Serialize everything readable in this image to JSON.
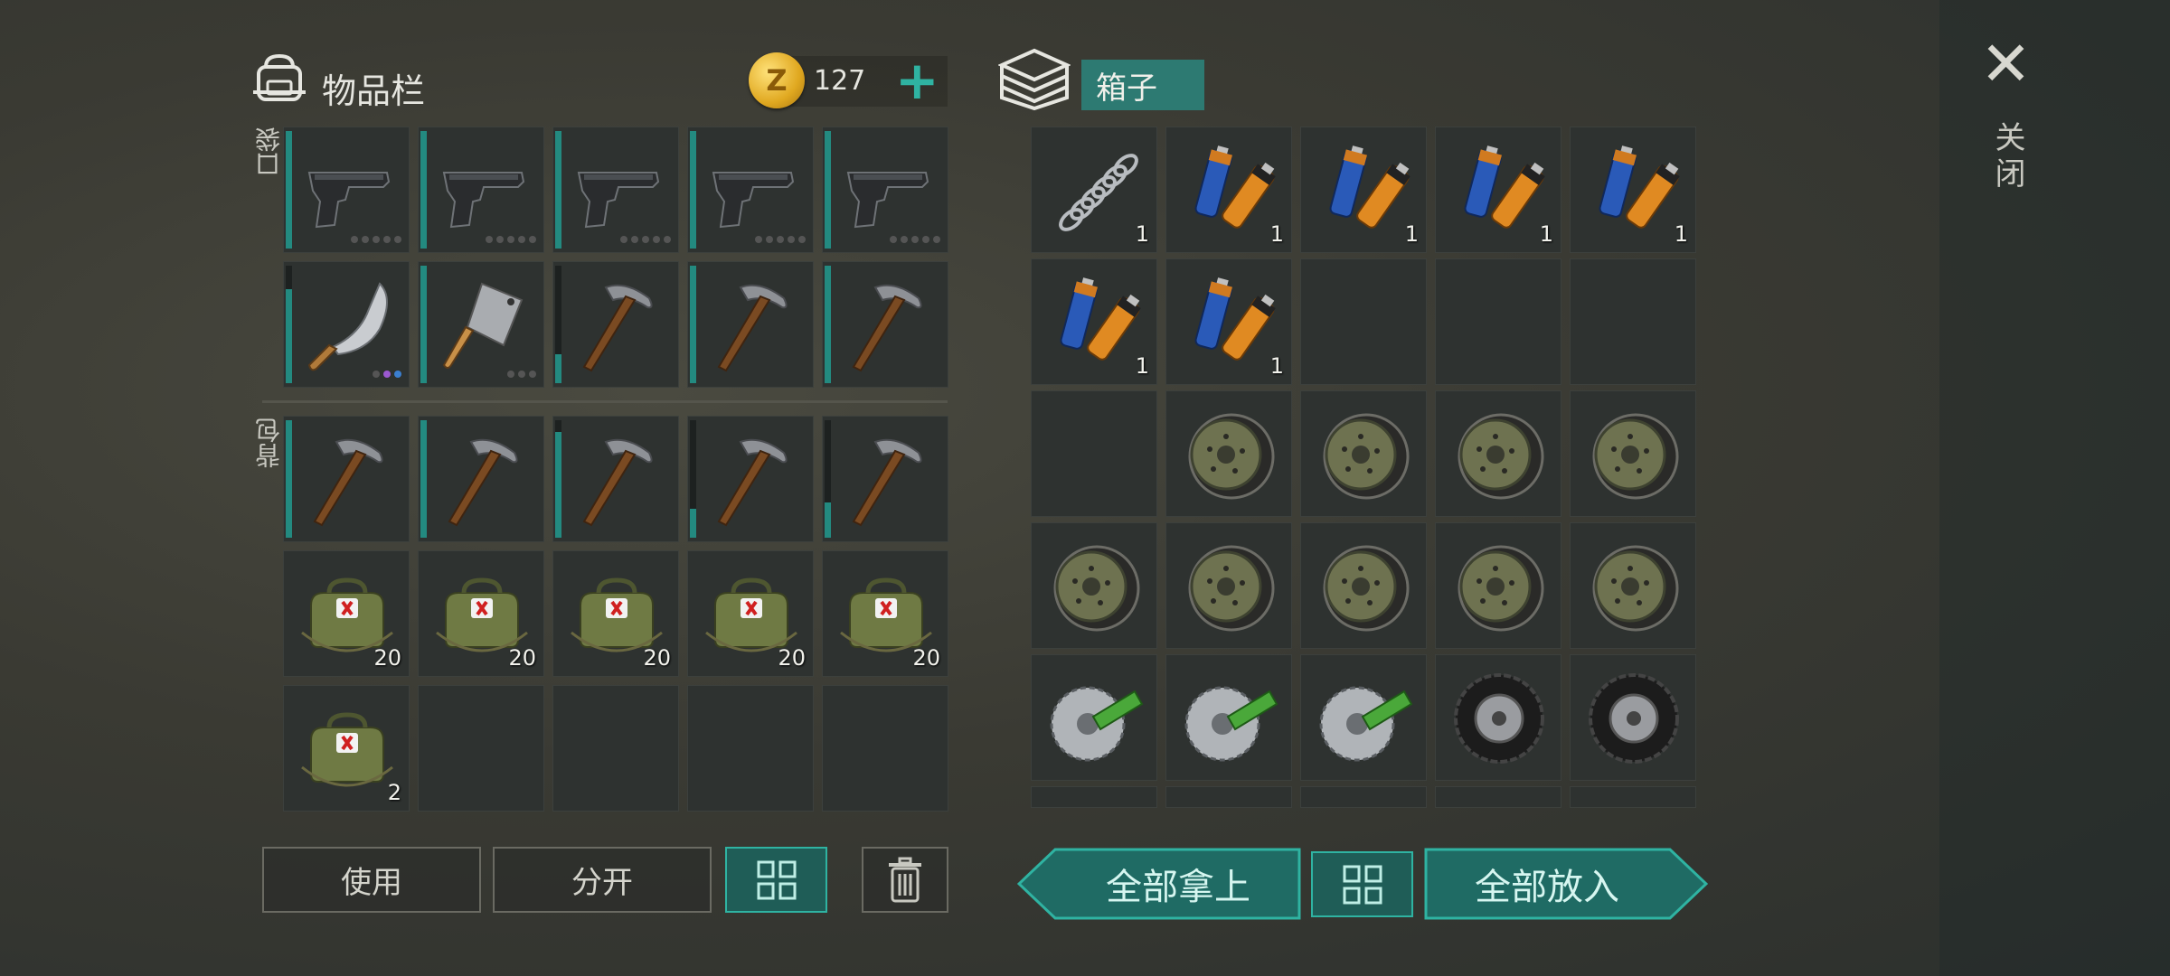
{
  "inventory": {
    "title": "物品栏",
    "coins": "127",
    "plus": "+",
    "pocket_label": "口袋",
    "backpack_label": "背包"
  },
  "container": {
    "title": "箱子"
  },
  "close": {
    "label": "关闭",
    "icon": "close-icon"
  },
  "buttons": {
    "use": "使用",
    "split": "分开",
    "take_all": "全部拿上",
    "put_all": "全部放入"
  },
  "pocket_slots": [
    {
      "item": "pistol-icon",
      "durability": 1.0,
      "dots": [
        "gray",
        "gray",
        "gray",
        "gray",
        "gray"
      ]
    },
    {
      "item": "pistol-icon",
      "durability": 1.0,
      "dots": [
        "gray",
        "gray",
        "gray",
        "gray",
        "gray"
      ]
    },
    {
      "item": "pistol-icon",
      "durability": 1.0,
      "dots": [
        "gray",
        "gray",
        "gray",
        "gray",
        "gray"
      ]
    },
    {
      "item": "pistol-icon",
      "durability": 1.0,
      "dots": [
        "gray",
        "gray",
        "gray",
        "gray",
        "gray"
      ]
    },
    {
      "item": "pistol-icon",
      "durability": 1.0,
      "dots": [
        "gray",
        "gray",
        "gray",
        "gray",
        "gray"
      ]
    },
    {
      "item": "machete-icon",
      "durability": 0.8,
      "dots": [
        "gray",
        "purple",
        "blue"
      ]
    },
    {
      "item": "cleaver-icon",
      "durability": 1.0,
      "dots": [
        "gray",
        "gray",
        "gray"
      ]
    },
    {
      "item": "pickaxe-icon",
      "durability": 0.25
    },
    {
      "item": "pickaxe-icon",
      "durability": 1.0
    },
    {
      "item": "pickaxe-icon",
      "durability": 1.0
    }
  ],
  "backpack_slots": [
    {
      "item": "pickaxe-icon",
      "durability": 1.0
    },
    {
      "item": "pickaxe-icon",
      "durability": 1.0
    },
    {
      "item": "pickaxe-icon",
      "durability": 0.9
    },
    {
      "item": "pickaxe-icon",
      "durability": 0.25
    },
    {
      "item": "pickaxe-icon",
      "durability": 0.3
    },
    {
      "item": "medkit-bag-icon",
      "qty": "20"
    },
    {
      "item": "medkit-bag-icon",
      "qty": "20"
    },
    {
      "item": "medkit-bag-icon",
      "qty": "20"
    },
    {
      "item": "medkit-bag-icon",
      "qty": "20"
    },
    {
      "item": "medkit-bag-icon",
      "qty": "20"
    },
    {
      "item": "medkit-bag-icon",
      "qty": "2"
    },
    {
      "item": ""
    },
    {
      "item": ""
    },
    {
      "item": ""
    },
    {
      "item": ""
    }
  ],
  "container_slots": [
    {
      "item": "spring-icon",
      "qty": "1"
    },
    {
      "item": "batteries-icon",
      "qty": "1"
    },
    {
      "item": "batteries-icon",
      "qty": "1"
    },
    {
      "item": "batteries-icon",
      "qty": "1"
    },
    {
      "item": "batteries-icon",
      "qty": "1"
    },
    {
      "item": "batteries-icon",
      "qty": "1"
    },
    {
      "item": "batteries-icon",
      "qty": "1"
    },
    {
      "item": ""
    },
    {
      "item": ""
    },
    {
      "item": ""
    },
    {
      "item": ""
    },
    {
      "item": "rim-icon"
    },
    {
      "item": "rim-icon"
    },
    {
      "item": "rim-icon"
    },
    {
      "item": "rim-icon"
    },
    {
      "item": "rim-icon"
    },
    {
      "item": "rim-icon"
    },
    {
      "item": "rim-icon"
    },
    {
      "item": "rim-icon"
    },
    {
      "item": "rim-icon"
    },
    {
      "item": "saw-blade-icon"
    },
    {
      "item": "saw-blade-icon"
    },
    {
      "item": "saw-blade-icon"
    },
    {
      "item": "tire-icon"
    },
    {
      "item": "tire-icon"
    }
  ],
  "colors": {
    "accent": "#2fb3a2",
    "slot_bg": "#2e3230",
    "durability": "#238a80"
  }
}
